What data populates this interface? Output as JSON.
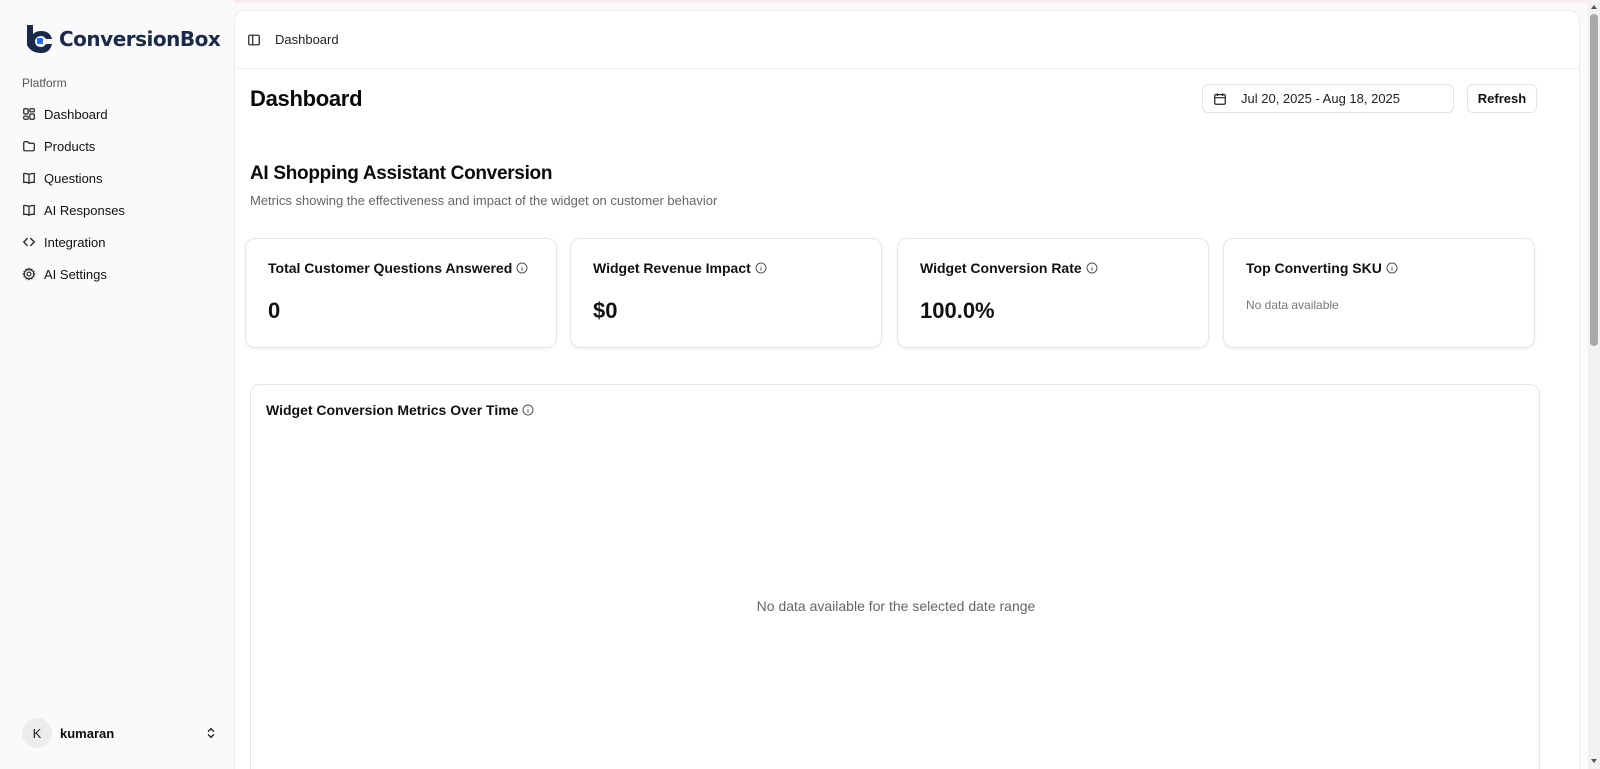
{
  "sidebar": {
    "logo_text": "ConversionBox",
    "section_label": "Platform",
    "items": [
      {
        "label": "Dashboard",
        "icon": "dashboard-icon"
      },
      {
        "label": "Products",
        "icon": "folder-icon"
      },
      {
        "label": "Questions",
        "icon": "book-icon"
      },
      {
        "label": "AI Responses",
        "icon": "book-icon"
      },
      {
        "label": "Integration",
        "icon": "code-icon"
      },
      {
        "label": "AI Settings",
        "icon": "gear-icon"
      }
    ],
    "user": {
      "initial": "K",
      "name": "kumaran"
    }
  },
  "header": {
    "breadcrumb": "Dashboard"
  },
  "main": {
    "title": "Dashboard",
    "date_range": "Jul 20, 2025 - Aug 18, 2025",
    "refresh_label": "Refresh",
    "section_title": "AI Shopping Assistant Conversion",
    "section_desc": "Metrics showing the effectiveness and impact of the widget on customer behavior",
    "cards": [
      {
        "title": "Total Customer Questions Answered",
        "value": "0"
      },
      {
        "title": "Widget Revenue Impact",
        "value": "$0"
      },
      {
        "title": "Widget Conversion Rate",
        "value": "100.0%"
      },
      {
        "title": "Top Converting SKU",
        "empty": "No data available"
      }
    ],
    "chart": {
      "title": "Widget Conversion Metrics Over Time",
      "empty": "No data available for the selected date range"
    }
  },
  "colors": {
    "brand": "#1b2a4a",
    "accent": "#1e6bff"
  }
}
